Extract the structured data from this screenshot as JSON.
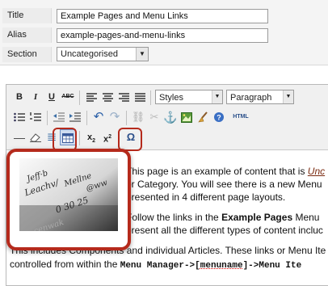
{
  "form": {
    "title_label": "Title",
    "title_value": "Example Pages and Menu Links",
    "alias_label": "Alias",
    "alias_value": "example-pages-and-menu-links",
    "section_label": "Section",
    "section_value": "Uncategorised"
  },
  "toolbar": {
    "bold": "B",
    "italic": "I",
    "underline": "U",
    "strike": "ABC",
    "styles_value": "Styles",
    "format_value": "Paragraph",
    "html": "HTML",
    "sub": "x",
    "sup": "x",
    "omega": "Ω"
  },
  "content": {
    "line1": "This page is an example of content that is ",
    "line1_em": "Unc",
    "line2": "or Category. You will see there is a new Menu",
    "line3": "presented in 4 different page layouts.",
    "line4_pre": "Follow the links in the ",
    "line4_bold": "Example Pages",
    "line4_post": " Menu",
    "line5": "present all the different types of content incluc",
    "line6": "This includes Components and individual Articles. These links or Menu Ite",
    "line7_pre": "controlled from within the ",
    "line7_mono1": "Menu Manager->[",
    "line7_mono2": "menuname",
    "line7_mono3": "]->Menu Ite"
  },
  "photo": {
    "handwriting": [
      "Jeff·b",
      "Leachv/",
      "Mellne",
      "@ww",
      "0 30 25",
      "cenwak"
    ]
  }
}
